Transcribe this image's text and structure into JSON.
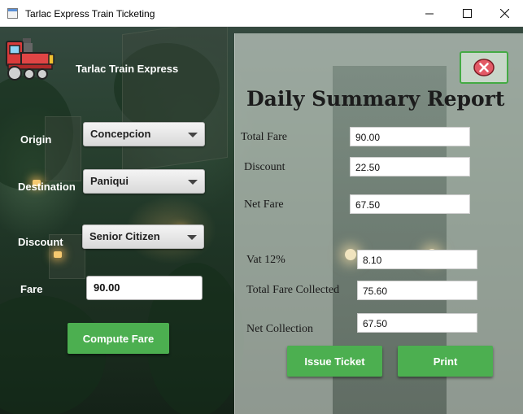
{
  "window": {
    "title": "Tarlac Express Train Ticketing"
  },
  "brand": {
    "name": "Tarlac Train Express"
  },
  "form": {
    "origin": {
      "label": "Origin",
      "value": "Concepcion"
    },
    "destination": {
      "label": "Destination",
      "value": "Paniqui"
    },
    "discount": {
      "label": "Discount",
      "value": "Senior Citizen"
    },
    "fare": {
      "label": "Fare",
      "value": "90.00"
    },
    "compute_label": "Compute Fare"
  },
  "report": {
    "title": "Daily Summary Report",
    "total_fare": {
      "label": "Total Fare",
      "value": "90.00"
    },
    "discount": {
      "label": "Discount",
      "value": "22.50"
    },
    "net_fare": {
      "label": "Net Fare",
      "value": "67.50"
    },
    "vat": {
      "label": "Vat 12%",
      "value": "8.10"
    },
    "total_collected": {
      "label": "Total Fare Collected",
      "value": "75.60"
    },
    "net_collection": {
      "label": "Net Collection",
      "value": "67.50"
    },
    "issue_label": "Issue Ticket",
    "print_label": "Print"
  },
  "icons": {
    "app": "window-app-icon",
    "logo": "train-icon",
    "close": "close-x-icon"
  },
  "colors": {
    "accent": "#4caf50",
    "close_icon": "#e35a66"
  }
}
